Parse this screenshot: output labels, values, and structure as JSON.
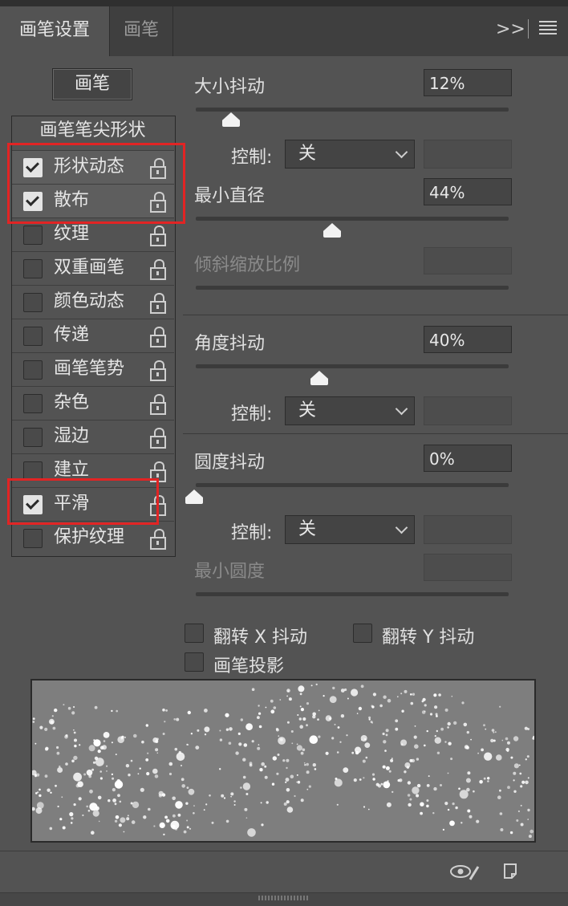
{
  "tabs": [
    {
      "label": "画笔设置",
      "active": true
    },
    {
      "label": "画笔",
      "active": false
    }
  ],
  "header_icons": {
    "collapse": ">>",
    "menu": "hamburger-icon"
  },
  "brush_button": {
    "label": "画笔"
  },
  "list": {
    "header": "画笔笔尖形状",
    "items": [
      {
        "label": "形状动态",
        "checked": true
      },
      {
        "label": "散布",
        "checked": true
      },
      {
        "label": "纹理",
        "checked": false
      },
      {
        "label": "双重画笔",
        "checked": false
      },
      {
        "label": "颜色动态",
        "checked": false
      },
      {
        "label": "传递",
        "checked": false
      },
      {
        "label": "画笔笔势",
        "checked": false
      },
      {
        "label": "杂色",
        "checked": false
      },
      {
        "label": "湿边",
        "checked": false
      },
      {
        "label": "建立",
        "checked": false
      },
      {
        "label": "平滑",
        "checked": true
      },
      {
        "label": "保护纹理",
        "checked": false
      }
    ],
    "highlight_color": "#e22424"
  },
  "settings": {
    "size_jitter": {
      "label": "大小抖动",
      "value": "12%",
      "slider": 0.12
    },
    "size_control": {
      "label": "控制:",
      "value": "关"
    },
    "min_diameter": {
      "label": "最小直径",
      "value": "44%",
      "slider": 0.44
    },
    "tilt_scale": {
      "label": "倾斜缩放比例"
    },
    "angle_jitter": {
      "label": "角度抖动",
      "value": "40%",
      "slider": 0.4
    },
    "angle_control": {
      "label": "控制:",
      "value": "关"
    },
    "roundness_jitter": {
      "label": "圆度抖动",
      "value": "0%",
      "slider": 0.0
    },
    "roundness_control": {
      "label": "控制:",
      "value": "关"
    },
    "min_roundness": {
      "label": "最小圆度"
    },
    "flip_x": {
      "label": "翻转 X 抖动",
      "checked": false
    },
    "flip_y": {
      "label": "翻转 Y 抖动",
      "checked": false
    },
    "brush_projection": {
      "label": "画笔投影",
      "checked": false
    }
  },
  "footer_icons": [
    "eye-brush-icon",
    "new-preset-icon"
  ]
}
